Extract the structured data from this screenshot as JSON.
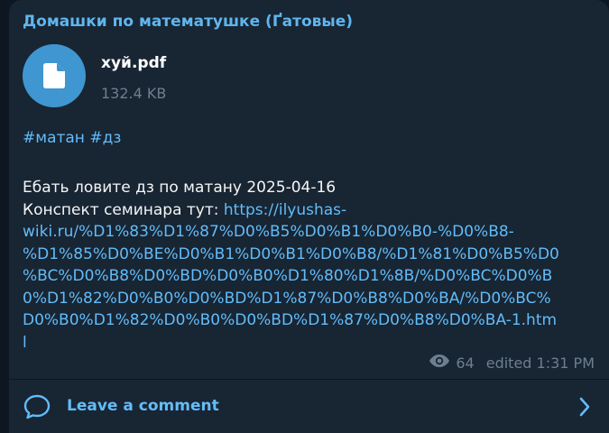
{
  "post": {
    "channel_title": "Домашки по математушке (Ґатовые)",
    "file": {
      "icon": "document-icon",
      "name": "хуй.pdf",
      "size": "132.4 KB"
    },
    "hashtags": [
      "#матан",
      "#дз"
    ],
    "text": {
      "line1": "Ебать ловите дз по матану 2025-04-16",
      "line2_prefix": "Конспект семинара тут: ",
      "link_start": "https://ilyushas-",
      "link_lines": [
        "wiki.ru/%D1%83%D1%87%D0%B5%D0%B1%D0%B0-%D0%B8-",
        "%D1%85%D0%BE%D0%B1%D0%B1%D0%B8/%D1%81%D0%B5%D0",
        "%BC%D0%B8%D0%BD%D0%B0%D1%80%D1%8B/%D0%BC%D0%B",
        "0%D1%82%D0%B0%D0%BD%D1%87%D0%B8%D0%BA/%D0%BC%",
        "D0%B0%D1%82%D0%B0%D0%BD%D1%87%D0%B8%D0%BA-1.htm",
        "l"
      ]
    },
    "meta": {
      "views_icon": "eye-icon",
      "views": "64",
      "status": "edited 1:31 PM"
    }
  },
  "comments": {
    "icon": "comment-bubble-icon",
    "label": "Leave a comment",
    "chevron": "chevron-right-icon"
  },
  "colors": {
    "background": "#0e1621",
    "bubble": "#182533",
    "accent": "#62bcf9",
    "title": "#5fb6ee",
    "file_icon_bg": "#3f96d0",
    "muted": "#6d7f8f"
  }
}
